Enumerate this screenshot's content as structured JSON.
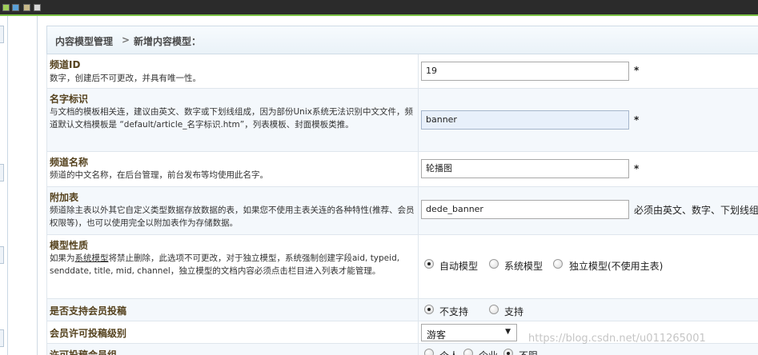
{
  "breadcrumb": {
    "parent": "内容模型管理",
    "separator": ">",
    "current": "新增内容模型："
  },
  "fields": [
    {
      "label": "频道ID",
      "desc": "数字，创建后不可更改，并具有唯一性。",
      "value": "19",
      "required": "*"
    },
    {
      "label": "名字标识",
      "desc": "与文档的模板相关连，建议由英文、数字或下划线组成，因为部份Unix系统无法识别中文文件，频道默认文档模板是 “default/article_名字标识.htm”，列表模板、封面模板类推。",
      "value": "banner",
      "required": "*"
    },
    {
      "label": "频道名称",
      "desc": "频道的中文名称，在后台管理，前台发布等均使用此名字。",
      "value": "轮播图",
      "required": "*"
    },
    {
      "label": "附加表",
      "desc": "频道除主表以外其它自定义类型数据存放数据的表，如果您不使用主表关连的各种特性(推荐、会员权限等)，也可以使用完全以附加表作为存储数据。",
      "value": "dede_banner",
      "hint": "必须由英文、数字、下划线组"
    },
    {
      "label": "模型性质",
      "desc_parts": {
        "pre": "如果为",
        "link": "系统模型",
        "post": "将禁止删除，此选项不可更改，对于独立模型，系统强制创建字段aid, typeid, senddate, title, mid, channel，独立模型的文档内容必须点击栏目进入列表才能管理。"
      },
      "options": [
        "自动模型",
        "系统模型",
        "独立模型(不使用主表)"
      ],
      "selected": "自动模型"
    },
    {
      "label": "是否支持会员投稿",
      "options": [
        "不支持",
        "支持"
      ],
      "selected": "不支持"
    },
    {
      "label": "会员许可投稿级别",
      "select_value": "游客"
    },
    {
      "label": "许可投稿会员组",
      "options": [
        "个人",
        "企业",
        "不限"
      ],
      "selected": "不限"
    }
  ],
  "watermark": "https://blog.csdn.net/u011265001"
}
